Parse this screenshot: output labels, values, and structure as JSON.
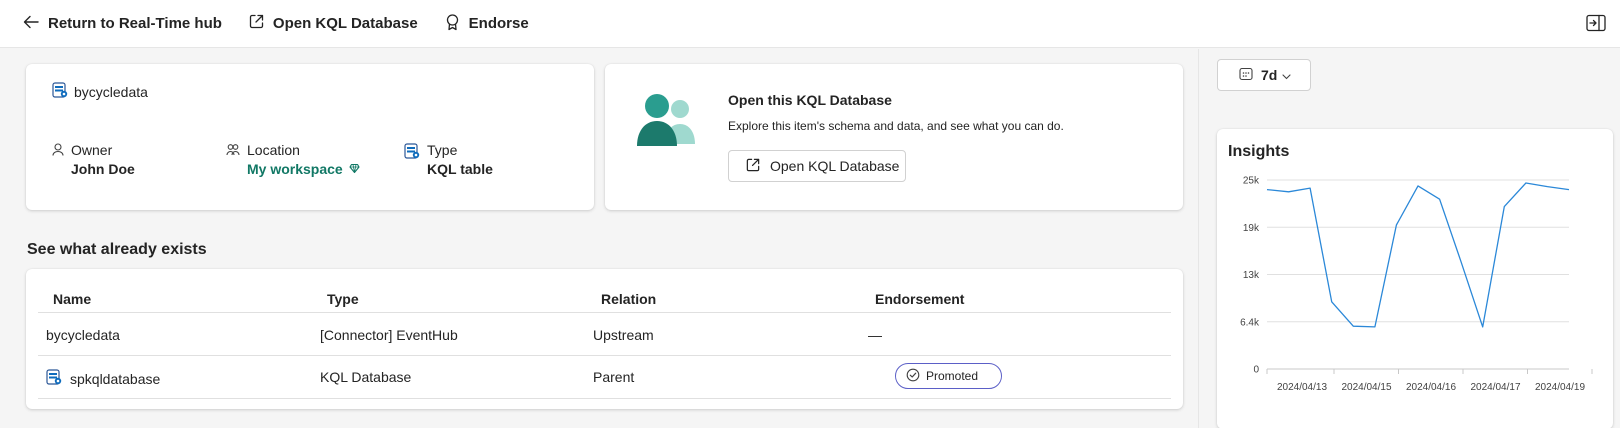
{
  "topbar": {
    "return_label": "Return to Real-Time hub",
    "open_db_label": "Open KQL Database",
    "endorse_label": "Endorse"
  },
  "info": {
    "item_name": "bycycledata",
    "owner_label": "Owner",
    "owner_value": "John Doe",
    "location_label": "Location",
    "location_value": "My workspace",
    "type_label": "Type",
    "type_value": "KQL table"
  },
  "open_card": {
    "title": "Open this KQL Database",
    "description": "Explore this item's schema and data, and see what you can do.",
    "button_label": "Open KQL Database"
  },
  "existing": {
    "title": "See what already exists",
    "columns": [
      "Name",
      "Type",
      "Relation",
      "Endorsement"
    ],
    "rows": [
      {
        "name": "bycycledata",
        "type": "[Connector] EventHub",
        "relation": "Upstream",
        "endorsement": "—"
      },
      {
        "name": "spkqldatabase",
        "type": "KQL Database",
        "relation": "Parent",
        "endorsement": "Promoted"
      }
    ]
  },
  "range": {
    "label": "7d"
  },
  "insights": {
    "title": "Insights"
  },
  "colors": {
    "accent": "#117865",
    "line": "#2b88d8",
    "badge_border": "#5b5fc7"
  },
  "chart_data": {
    "type": "line",
    "title": "Insights",
    "y_ticks": [
      "0",
      "6.4k",
      "13k",
      "19k",
      "25k"
    ],
    "ylim": [
      0,
      25600
    ],
    "x_tick_labels": [
      "2024/04/13",
      "2024/04/15",
      "2024/04/16",
      "2024/04/17",
      "2024/04/19"
    ],
    "x_tick_index": [
      0,
      2,
      4,
      6,
      8
    ],
    "series": [
      {
        "values": [
          24300,
          24000,
          24500,
          9100,
          5800,
          5700,
          19500,
          24800,
          23000,
          14500,
          5700,
          22000,
          25200,
          24700,
          24300
        ]
      }
    ],
    "grid": true
  }
}
